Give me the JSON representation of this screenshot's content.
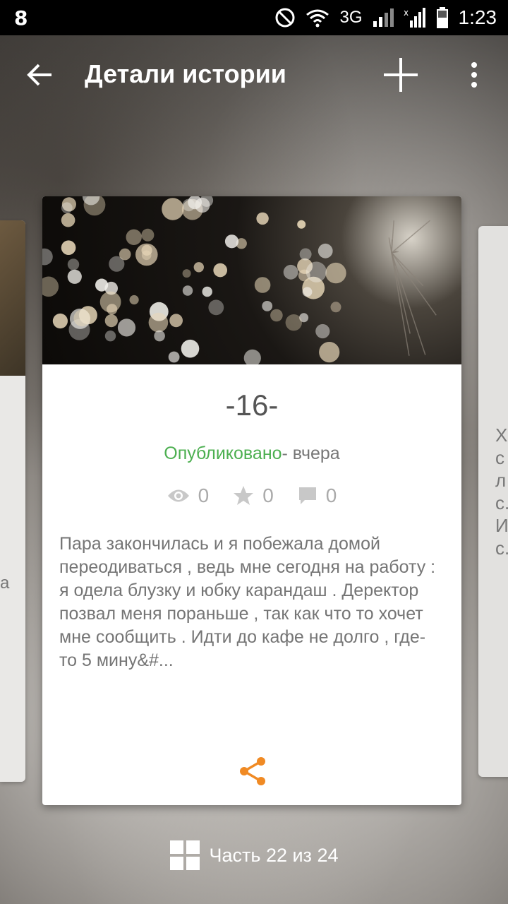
{
  "status_bar": {
    "time": "1:23",
    "network_type": "3G",
    "icons": [
      "notification-icon",
      "do-not-disturb-icon",
      "wifi-icon",
      "signal-icon",
      "signal-off-icon",
      "battery-icon"
    ]
  },
  "app_bar": {
    "title": "Детали истории",
    "icons": [
      "back-arrow-icon",
      "add-icon",
      "more-vert-icon"
    ]
  },
  "story": {
    "title": "-16-",
    "status": "Опубликовано",
    "time": "- вчера",
    "stats": {
      "views": "0",
      "votes": "0",
      "comments": "0"
    },
    "excerpt": "Пара закончилась и я побежала домой переодиваться , ведь мне сегодня на работу : я одела блузку и юбку карандаш . Деректор позвал меня пораньше , так как что то хочет мне сообщить . Идти до кафе не долго , где-то 5 мину&#..."
  },
  "side_card_right": {
    "lines": [
      "Х",
      "с",
      "л",
      "с.",
      "И",
      "с."
    ]
  },
  "side_card_left": {
    "text": "a"
  },
  "parts": {
    "label": "Часть 22 из 24"
  },
  "colors": {
    "accent": "#f08a24",
    "published": "#4caf50"
  }
}
